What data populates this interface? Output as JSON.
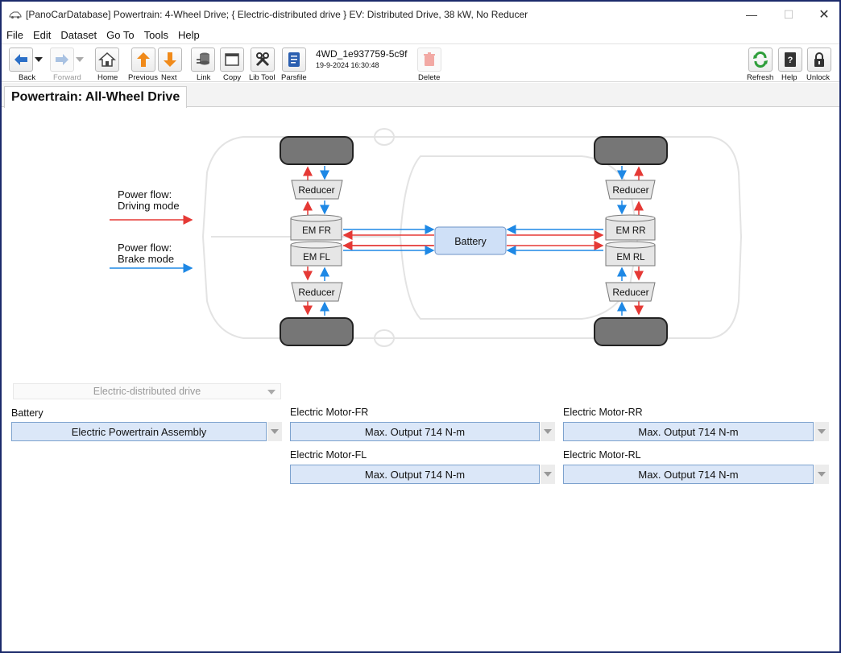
{
  "window": {
    "title": "[PanoCarDatabase] Powertrain: 4-Wheel Drive; { Electric-distributed drive } EV: Distributed Drive, 38 kW, No Reducer"
  },
  "menu": [
    "File",
    "Edit",
    "Dataset",
    "Go To",
    "Tools",
    "Help"
  ],
  "toolbar": {
    "back": "Back",
    "forward": "Forward",
    "home": "Home",
    "previous": "Previous",
    "next": "Next",
    "link": "Link",
    "copy": "Copy",
    "lib_tool": "Lib Tool",
    "parsfile": "Parsfile",
    "record_id": "4WD_1e937759-5c9f",
    "record_date": "19-9-2024 16:30:48",
    "delete": "Delete",
    "refresh": "Refresh",
    "help": "Help",
    "unlock": "Unlock"
  },
  "tab": {
    "label": "Powertrain: All-Wheel Drive"
  },
  "diagram": {
    "legend_driving": "Power flow:\nDriving mode",
    "legend_driving_line1": "Power flow:",
    "legend_driving_line2": "Driving mode",
    "legend_brake_line1": "Power flow:",
    "legend_brake_line2": "Brake mode",
    "battery": "Battery",
    "reducer": "Reducer",
    "em_fr": "EM FR",
    "em_fl": "EM FL",
    "em_rr": "EM RR",
    "em_rl": "EM RL",
    "colors": {
      "driving": "#e53935",
      "brake": "#1e88e5",
      "battery_fill": "#cfe0f7"
    }
  },
  "form": {
    "drive_mode": "Electric-distributed drive",
    "battery_label": "Battery",
    "battery_value": "Electric Powertrain Assembly",
    "em_fr_label": "Electric Motor-FR",
    "em_fr_value": "Max. Output 714 N-m",
    "em_rr_label": "Electric Motor-RR",
    "em_rr_value": "Max. Output 714 N-m",
    "em_fl_label": "Electric Motor-FL",
    "em_fl_value": "Max. Output 714 N-m",
    "em_rl_label": "Electric Motor-RL",
    "em_rl_value": "Max. Output 714 N-m"
  }
}
